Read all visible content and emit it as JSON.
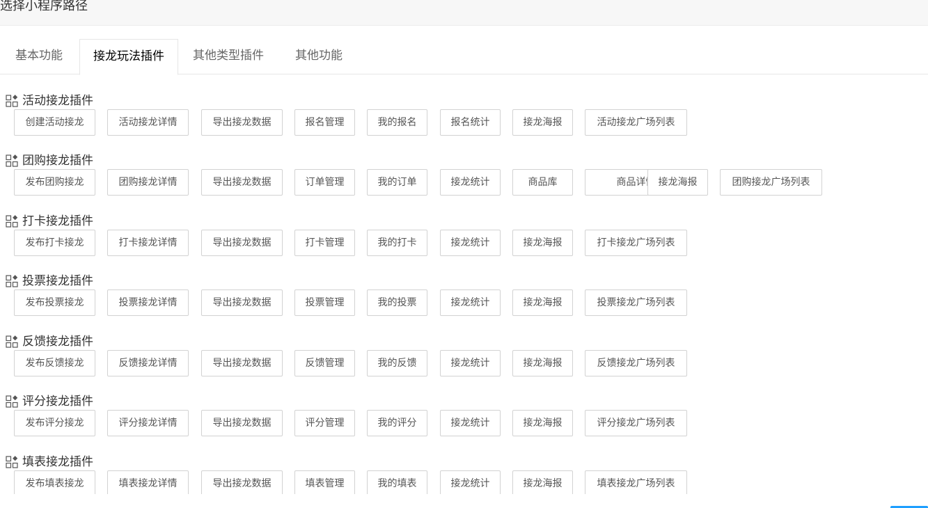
{
  "header": {
    "title": "选择小程序路径"
  },
  "tabs": [
    {
      "label": "基本功能"
    },
    {
      "label": "接龙玩法插件"
    },
    {
      "label": "其他类型插件"
    },
    {
      "label": "其他功能"
    }
  ],
  "active_tab": "接龙玩法插件",
  "icon": "grid-apps-icon",
  "sections": [
    {
      "title": "活动接龙插件",
      "buttons": [
        "创建活动接龙",
        "活动接龙详情",
        "导出接龙数据",
        "报名管理",
        "我的报名",
        "报名统计",
        "接龙海报",
        "活动接龙广场列表"
      ]
    },
    {
      "title": "团购接龙插件",
      "buttons": [
        "发布团购接龙",
        "团购接龙详情",
        "导出接龙数据",
        "订单管理",
        "我的订单",
        "接龙统计",
        "商品库",
        "商品详情",
        "接龙海报",
        "团购接龙广场列表"
      ]
    },
    {
      "title": "打卡接龙插件",
      "buttons": [
        "发布打卡接龙",
        "打卡接龙详情",
        "导出接龙数据",
        "打卡管理",
        "我的打卡",
        "接龙统计",
        "接龙海报",
        "打卡接龙广场列表"
      ]
    },
    {
      "title": "投票接龙插件",
      "buttons": [
        "发布投票接龙",
        "投票接龙详情",
        "导出接龙数据",
        "投票管理",
        "我的投票",
        "接龙统计",
        "接龙海报",
        "投票接龙广场列表"
      ]
    },
    {
      "title": "反馈接龙插件",
      "buttons": [
        "发布反馈接龙",
        "反馈接龙详情",
        "导出接龙数据",
        "反馈管理",
        "我的反馈",
        "接龙统计",
        "接龙海报",
        "反馈接龙广场列表"
      ]
    },
    {
      "title": "评分接龙插件",
      "buttons": [
        "发布评分接龙",
        "评分接龙详情",
        "导出接龙数据",
        "评分管理",
        "我的评分",
        "接龙统计",
        "接龙海报",
        "评分接龙广场列表"
      ]
    },
    {
      "title": "填表接龙插件",
      "buttons": [
        "发布填表接龙",
        "填表接龙详情",
        "导出接龙数据",
        "填表管理",
        "我的填表",
        "接龙统计",
        "接龙海报",
        "填表接龙广场列表"
      ]
    }
  ]
}
